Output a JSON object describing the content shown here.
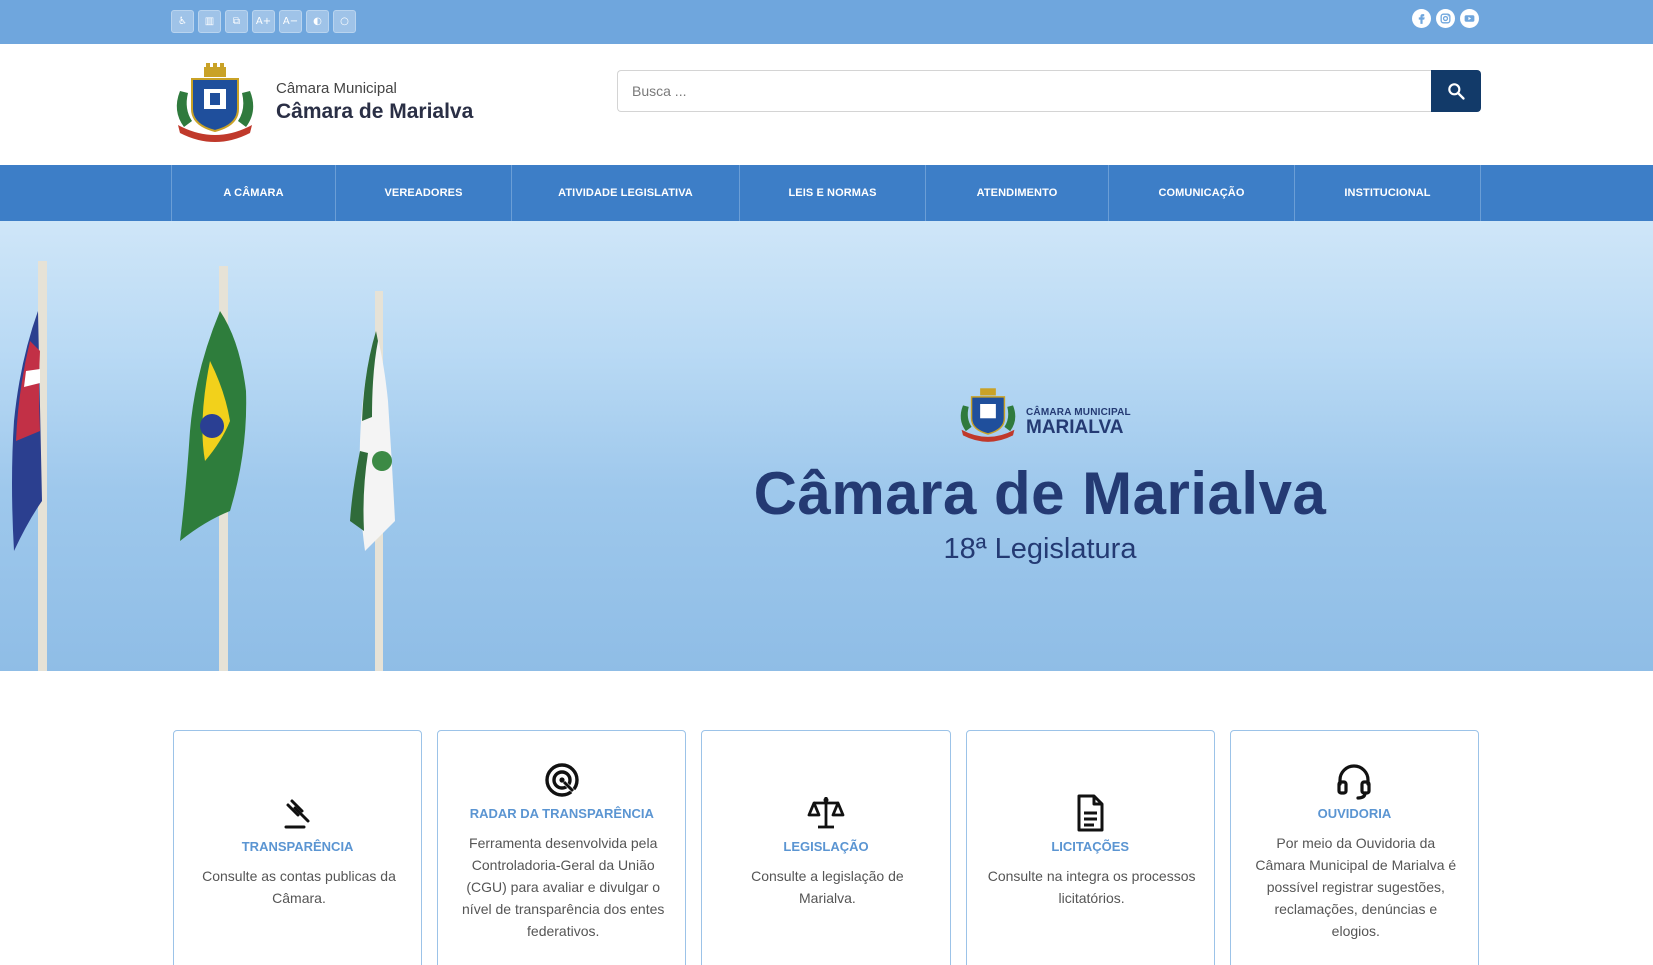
{
  "accessibility_bar": {
    "buttons": [
      {
        "icon": "wheelchair-icon",
        "glyph": "♿"
      },
      {
        "icon": "book-icon",
        "glyph": "▥"
      },
      {
        "icon": "document-search-icon",
        "glyph": "⧉"
      },
      {
        "icon": "font-increase-icon",
        "glyph": "A+"
      },
      {
        "icon": "font-decrease-icon",
        "glyph": "A−"
      },
      {
        "icon": "contrast-icon",
        "glyph": "◐"
      },
      {
        "icon": "reset-circle-icon",
        "glyph": "○"
      }
    ]
  },
  "social": [
    {
      "icon": "facebook-icon"
    },
    {
      "icon": "instagram-icon"
    },
    {
      "icon": "youtube-icon"
    }
  ],
  "header": {
    "brand_small": "Câmara Municipal",
    "brand_big": "Câmara de Marialva",
    "search_placeholder": "Busca ..."
  },
  "nav": {
    "items": [
      {
        "label": "A CÂMARA"
      },
      {
        "label": "VEREADORES"
      },
      {
        "label": "ATIVIDADE LEGISLATIVA"
      },
      {
        "label": "LEIS E NORMAS"
      },
      {
        "label": "ATENDIMENTO"
      },
      {
        "label": "COMUNICAÇÃO"
      },
      {
        "label": "INSTITUCIONAL"
      }
    ]
  },
  "hero": {
    "logo_small": "CÂMARA MUNICIPAL",
    "logo_big": "MARIALVA",
    "title": "Câmara de Marialva",
    "subtitle": "18ª Legislatura"
  },
  "cards": [
    {
      "icon": "gavel-icon",
      "title": "TRANSPARÊNCIA",
      "text": "Consulte as contas publicas da Câmara."
    },
    {
      "icon": "radar-icon",
      "title": "RADAR DA TRANSPARÊNCIA",
      "text": "Ferramenta desenvolvida pela Controladoria-Geral da União (CGU) para avaliar e divulgar o nível de transparência dos entes federativos."
    },
    {
      "icon": "scales-icon",
      "title": "LEGISLAÇÃO",
      "text": "Consulte a legislação de Marialva."
    },
    {
      "icon": "document-icon",
      "title": "LICITAÇÕES",
      "text": "Consulte na integra os processos licitatórios."
    },
    {
      "icon": "headset-icon",
      "title": "OUVIDORIA",
      "text": "Por meio da Ouvidoria da Câmara Municipal de Marialva é possível registrar sugestões, reclamações, denúncias e elogios."
    }
  ],
  "colors": {
    "topbar": "#6fa6dd",
    "nav": "#3d7ec7",
    "accent_dark": "#123a69",
    "hero_text": "#243a73",
    "card_title": "#5b95d2"
  }
}
